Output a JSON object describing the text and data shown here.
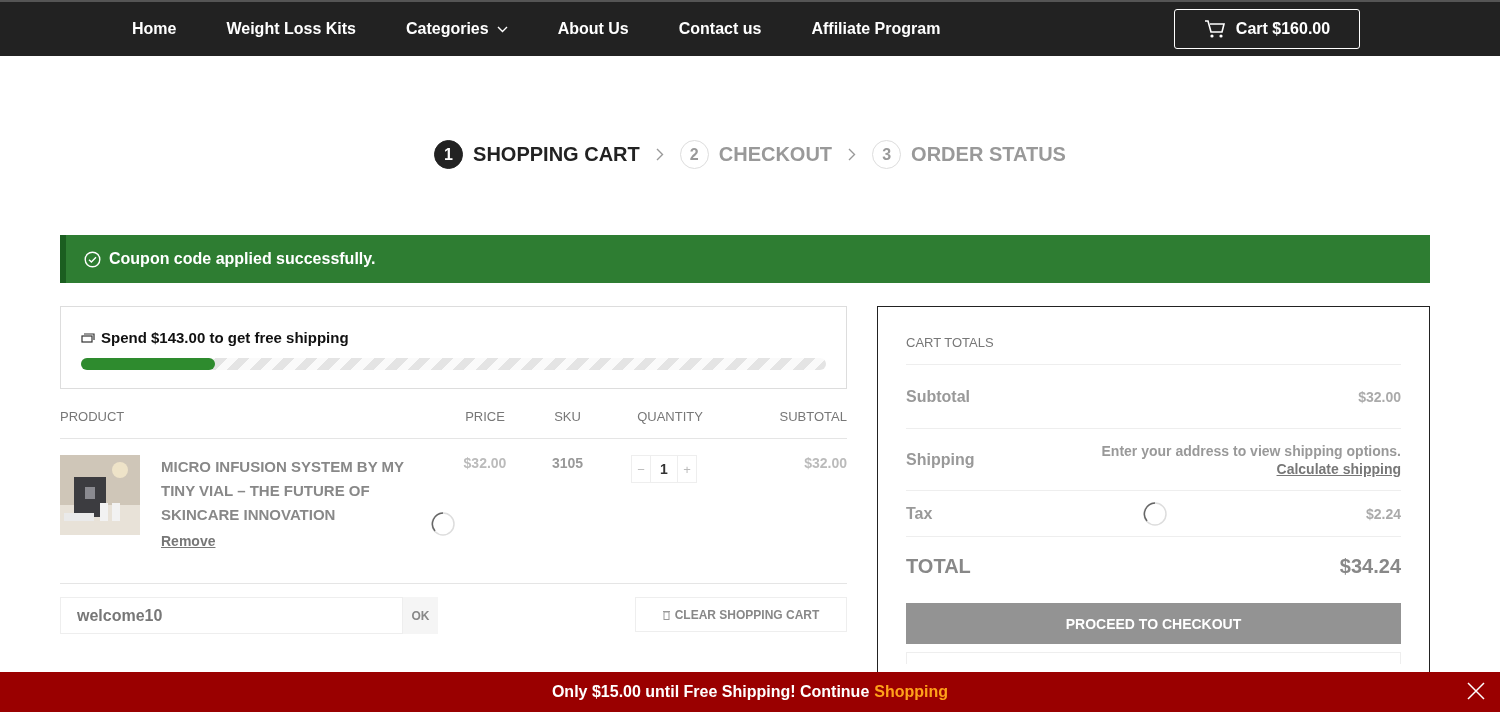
{
  "nav": {
    "items": [
      {
        "label": "Home",
        "has_dropdown": false
      },
      {
        "label": "Weight Loss Kits",
        "has_dropdown": false
      },
      {
        "label": "Categories",
        "has_dropdown": true
      },
      {
        "label": "About Us",
        "has_dropdown": false
      },
      {
        "label": "Contact us",
        "has_dropdown": false
      },
      {
        "label": "Affiliate Program",
        "has_dropdown": false
      }
    ],
    "cart": {
      "label": "Cart $160.00"
    }
  },
  "steps": [
    {
      "number": "1",
      "label": "SHOPPING CART",
      "selected": true
    },
    {
      "number": "2",
      "label": "CHECKOUT",
      "selected": false
    },
    {
      "number": "3",
      "label": "ORDER STATUS",
      "selected": false
    }
  ],
  "notice": {
    "message": "Coupon code applied successfully."
  },
  "free_shipping": {
    "message": "Spend $143.00 to get free shipping",
    "level": 0.18
  },
  "table": {
    "columns": [
      "PRODUCT",
      "PRICE",
      "SKU",
      "QUANTITY",
      "SUBTOTAL"
    ],
    "rows": [
      {
        "name": "MICRO INFUSION SYSTEM BY MY TINY VIAL – THE FUTURE OF SKINCARE INNOVATION",
        "remove": "Remove",
        "price": "$32.00",
        "sku": "3105",
        "minus": "−",
        "quantity": "1",
        "plus": "+",
        "subtotal": "$32.00"
      }
    ]
  },
  "coupon": {
    "value": "welcome10",
    "button": "OK"
  },
  "clear_button": "CLEAR SHOPPING CART",
  "totals": {
    "title": "CART TOTALS",
    "rows": [
      {
        "kind": "amount",
        "label": "Subtotal",
        "value": "$32.00"
      },
      {
        "kind": "shipping",
        "label": "Shipping",
        "note": "Enter your address to view shipping options.",
        "link": "Calculate shipping"
      },
      {
        "kind": "amount",
        "label": "Tax",
        "value": "$2.24"
      }
    ],
    "total": {
      "label": "TOTAL",
      "value": "$34.24"
    },
    "checkout_button": "PROCEED TO CHECKOUT"
  },
  "bottom_bar": {
    "message": "Only $15.00 until Free Shipping! Continue",
    "link": "Shopping"
  }
}
